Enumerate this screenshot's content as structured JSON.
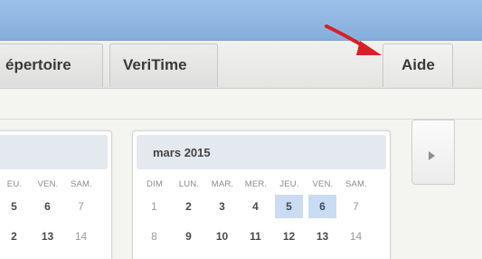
{
  "tabs": {
    "repertoire": "épertoire",
    "veritime": "VeriTime",
    "aide": "Aide"
  },
  "left_calendar": {
    "weekdays": [
      "EU.",
      "VEN.",
      "SAM."
    ],
    "row1": [
      "5",
      "6",
      "7"
    ],
    "row2": [
      "2",
      "13",
      "14"
    ]
  },
  "right_calendar": {
    "title": "mars 2015",
    "weekdays": [
      "DIM",
      "LUN.",
      "MAR.",
      "MER.",
      "JEU.",
      "VEN.",
      "SAM."
    ],
    "row1": [
      "1",
      "2",
      "3",
      "4",
      "5",
      "6",
      "7"
    ],
    "row2": [
      "8",
      "9",
      "10",
      "11",
      "12",
      "13",
      "14"
    ],
    "selected_days": [
      "5",
      "6"
    ]
  },
  "colors": {
    "titlebar": "#8fb6e1",
    "selected_day": "#c9dcf2",
    "arrow": "#d81f26"
  },
  "icons": {
    "annotation": "red-arrow-icon",
    "next": "chevron-right-icon"
  }
}
